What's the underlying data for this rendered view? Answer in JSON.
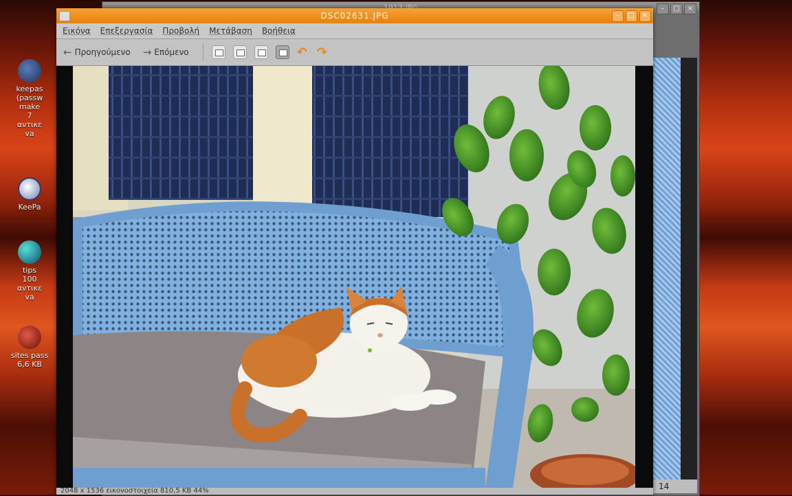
{
  "desktop": {
    "icons": [
      {
        "name": "keepass-folder-icon",
        "label": "keepas\n(passw\nmake\n7\nαντικε\nva"
      },
      {
        "name": "keepass-lock-icon",
        "label": "KeePa"
      },
      {
        "name": "tips-globe-icon",
        "label": "tips\n100\nαντικε\nva"
      },
      {
        "name": "sites-pass-icon",
        "label": "sites pass\n6,6 KB"
      }
    ]
  },
  "background_window": {
    "title": "1913.JPG",
    "status_count": "14"
  },
  "window": {
    "title": "DSC02631.JPG",
    "menu": [
      "Εικόνα",
      "Επεξεργασία",
      "Προβολή",
      "Μετάβαση",
      "Βοήθεια"
    ],
    "toolbar": {
      "previous": "Προηγούμενο",
      "next": "Επόμενο"
    },
    "status": "2048 x 1536 εικονοστοιχεία  810,5 KB  44%"
  },
  "colors": {
    "titlebar": "#e6810f",
    "bench": "#6f9fd0",
    "cushion": "#8d8486"
  }
}
